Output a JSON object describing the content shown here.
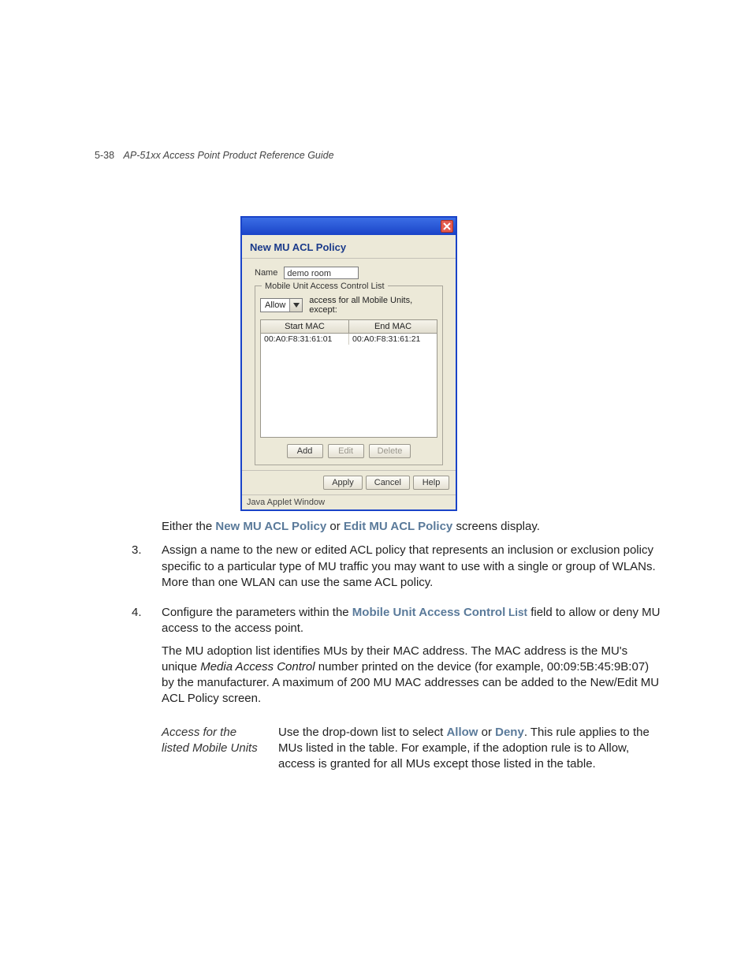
{
  "header": {
    "page_num": "5-38",
    "title": "AP-51xx Access Point Product Reference Guide"
  },
  "dialog": {
    "title": "New MU ACL Policy",
    "name_label": "Name",
    "name_value": "demo room",
    "fieldset_legend": "Mobile Unit Access Control List",
    "allow_combo": "Allow",
    "allow_suffix": "access for all Mobile Units, except:",
    "col_start": "Start MAC",
    "col_end": "End MAC",
    "rows": [
      {
        "start": "00:A0:F8:31:61:01",
        "end": "00:A0:F8:31:61:21"
      }
    ],
    "btn_add": "Add",
    "btn_edit": "Edit",
    "btn_delete": "Delete",
    "btn_apply": "Apply",
    "btn_cancel": "Cancel",
    "btn_help": "Help",
    "status": "Java Applet Window"
  },
  "body": {
    "line_either_a": "Either the ",
    "line_either_link1": "New MU ACL Policy",
    "line_either_b": " or ",
    "line_either_link2": "Edit MU ACL Policy",
    "line_either_c": " screens display.",
    "step3_num": "3.",
    "step3": "Assign a name to the new or edited ACL policy that represents an inclusion or exclusion policy specific to a particular type of MU traffic you may want to use with a single or group of WLANs. More than one WLAN can use the same ACL policy.",
    "step4_num": "4.",
    "step4_a": "Configure the parameters within the ",
    "step4_link": "Mobile Unit Access Control",
    "step4_list": " List",
    "step4_b": " field to allow or deny MU access to the access point.",
    "step4_para2_a": "The MU adoption list identifies MUs by their MAC address. The MAC address is the MU's unique ",
    "step4_para2_i": "Media Access Control",
    "step4_para2_b": " number printed on the device (for example, 00:09:5B:45:9B:07) by the manufacturer. A maximum of 200 MU MAC addresses can be added to the New/Edit MU ACL Policy screen.",
    "def_term": "Access for the listed Mobile Units",
    "def_a": "Use the drop-down list to select ",
    "def_allow": "Allow",
    "def_b": " or ",
    "def_deny": "Deny",
    "def_c": ". This rule applies to the MUs listed in the table. For example, if the adoption rule is to Allow, access is granted for all MUs except those listed in the table."
  }
}
